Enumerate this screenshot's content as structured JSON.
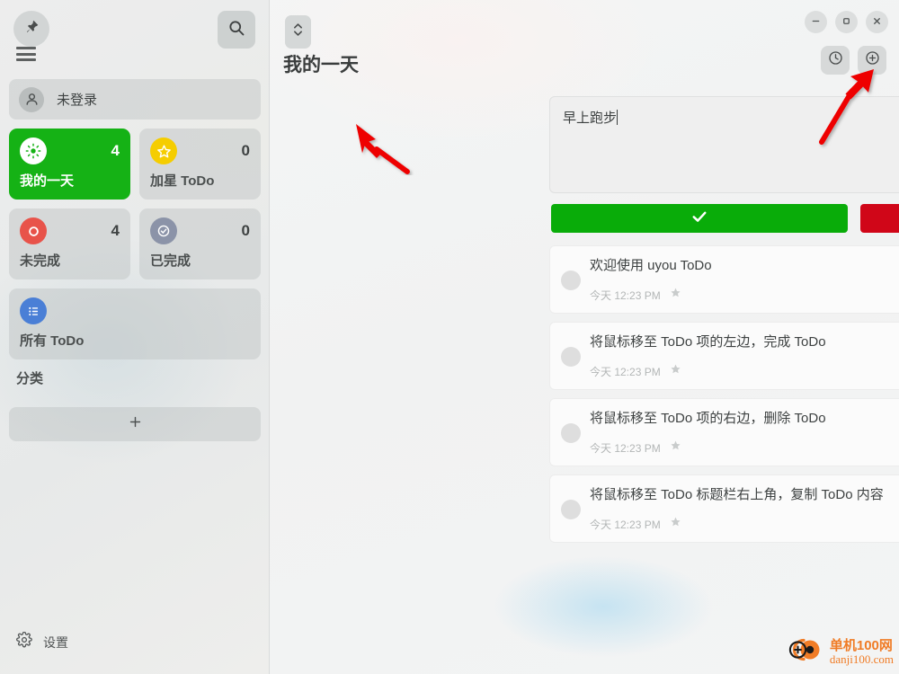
{
  "sidebar": {
    "pin_icon": "pushpin-icon",
    "search_icon": "search-icon",
    "menu_icon": "hamburger-menu-icon",
    "account": {
      "label": "未登录",
      "avatar_icon": "user-avatar-icon"
    },
    "cards": [
      {
        "label": "我的一天",
        "count": "4",
        "icon": "sun-icon",
        "icon_color": "#ffffff",
        "active": true,
        "accent": "#15b215"
      },
      {
        "label": "加星 ToDo",
        "count": "0",
        "icon": "star-icon",
        "icon_color": "#f5cd00",
        "active": false
      },
      {
        "label": "未完成",
        "count": "4",
        "icon": "circle-outline-icon",
        "icon_color": "#e8534a",
        "active": false
      },
      {
        "label": "已完成",
        "count": "0",
        "icon": "check-circle-icon",
        "icon_color": "#8b93a8",
        "active": false
      },
      {
        "label": "所有 ToDo",
        "count": "",
        "icon": "list-icon",
        "icon_color": "#4a7fd6",
        "active": false
      }
    ],
    "category_section_title": "分类",
    "add_category_icon": "plus-icon",
    "settings": {
      "label": "设置",
      "icon": "gear-icon"
    }
  },
  "main": {
    "sort_button_icon": "sort-up-down-icon",
    "title": "我的一天",
    "window_controls": [
      {
        "name": "minimize",
        "icon": "minimize-icon"
      },
      {
        "name": "maximize",
        "icon": "maximize-icon"
      },
      {
        "name": "close",
        "icon": "close-icon"
      }
    ],
    "header_actions": [
      {
        "name": "history",
        "icon": "clock-icon"
      },
      {
        "name": "add-todo",
        "icon": "plus-circle-icon"
      }
    ],
    "composer": {
      "value": "早上跑步",
      "placeholder": "",
      "confirm_icon": "checkmark-icon",
      "confirm_color": "#09ac09",
      "cancel_icon": "cross-icon",
      "cancel_color": "#d00618"
    },
    "todos": [
      {
        "title": "欢迎使用 uyou ToDo",
        "time": "今天 12:23 PM",
        "star_icon": "star-icon",
        "done": false
      },
      {
        "title": "将鼠标移至 ToDo 项的左边，完成 ToDo",
        "time": "今天 12:23 PM",
        "star_icon": "star-icon",
        "done": false
      },
      {
        "title": "将鼠标移至 ToDo 项的右边，删除 ToDo",
        "time": "今天 12:23 PM",
        "star_icon": "star-icon",
        "done": false
      },
      {
        "title": "将鼠标移至 ToDo 标题栏右上角，复制 ToDo 内容",
        "time": "今天 12:23 PM",
        "star_icon": "star-icon",
        "done": false
      }
    ]
  },
  "watermark": {
    "line1": "单机100网",
    "line2": "danji100.com",
    "color": "#f07c26",
    "logo_icon": "danji100-logo-icon"
  },
  "annotations": {
    "arrow_color": "#ee0000",
    "arrows": [
      {
        "name": "arrow-to-composer-input"
      },
      {
        "name": "arrow-to-add-todo-button"
      }
    ]
  }
}
